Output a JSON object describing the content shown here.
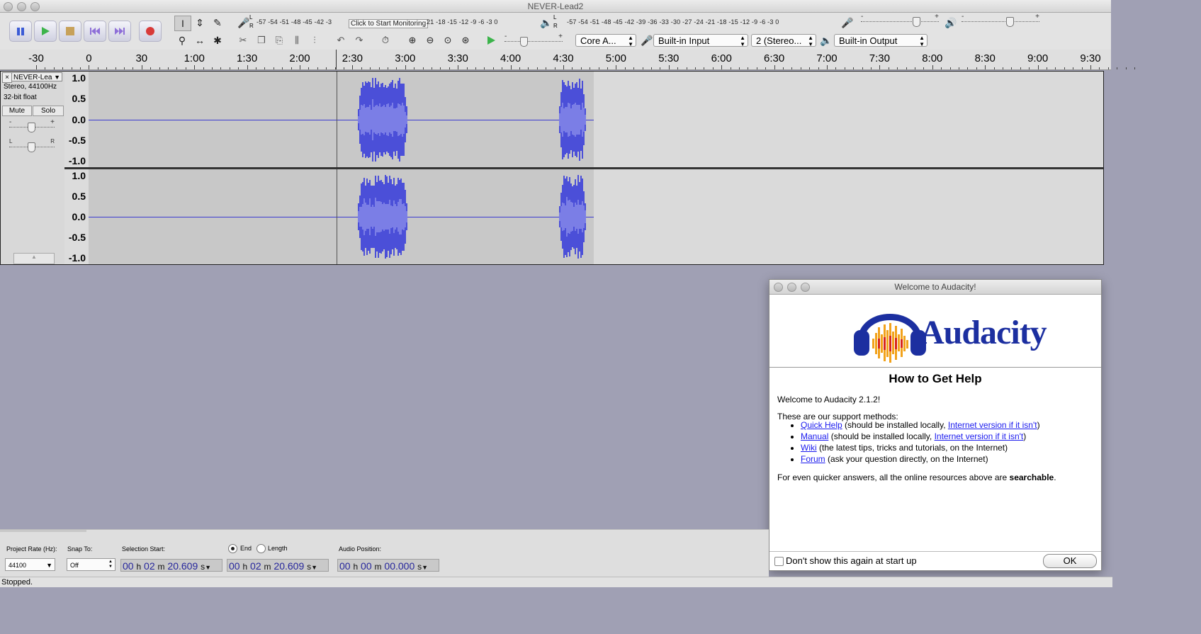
{
  "window": {
    "title": "NEVER-Lead2"
  },
  "meters": {
    "record_scale": "-57 -54 -51 -48 -45 -42 -3",
    "record_scale_right": "21 -18 -15 -12 -9 -6 -3 0",
    "record_tip": "Click to Start Monitoring",
    "play_scale": "-57 -54 -51 -48 -45 -42 -39 -36 -33 -30 -27 -24 -21 -18 -15 -12 -9 -6 -3 0",
    "lr_left": "L",
    "lr_right": "R"
  },
  "device": {
    "host": "Core A...",
    "input": "Built-in Input",
    "channels": "2 (Stereo...",
    "output": "Built-in Output"
  },
  "slider_marks": {
    "minus": "-",
    "plus": "+"
  },
  "ruler": [
    "-30",
    "0",
    "30",
    "1:00",
    "1:30",
    "2:00",
    "2:30",
    "3:00",
    "3:30",
    "4:00",
    "4:30",
    "5:00",
    "5:30",
    "6:00",
    "6:30",
    "7:00",
    "7:30",
    "8:00",
    "8:30",
    "9:00",
    "9:30"
  ],
  "track": {
    "close": "×",
    "name": "NEVER-Lea",
    "format": "Stereo, 44100Hz",
    "bits": "32-bit float",
    "mute": "Mute",
    "solo": "Solo",
    "pan_left": "L",
    "pan_right": "R",
    "gain_minus": "-",
    "gain_plus": "+"
  },
  "vaxis": [
    "1.0",
    "0.5",
    "0.0",
    "-0.5",
    "-1.0"
  ],
  "welcome": {
    "title": "Welcome to Audacity!",
    "logo_text": "Audacity",
    "heading": "How to Get Help",
    "intro": "Welcome to Audacity 2.1.2!",
    "methods_label": "These are our support methods:",
    "items": [
      {
        "link": "Quick Help",
        "text": " (should be installed locally, ",
        "link2": "Internet version if it isn't",
        "tail": ")"
      },
      {
        "link": "Manual",
        "text": " (should be installed locally, ",
        "link2": "Internet version if it isn't",
        "tail": ")"
      },
      {
        "link": "Wiki",
        "text": " (the latest tips, tricks and tutorials, on the Internet)",
        "link2": "",
        "tail": ""
      },
      {
        "link": "Forum",
        "text": " (ask your question directly, on the Internet)",
        "link2": "",
        "tail": ""
      }
    ],
    "quicker_prefix": "For even quicker answers, all the online resources above are ",
    "quicker_bold": "searchable",
    "quicker_suffix": ".",
    "dont_show": "Don't show this again at start up",
    "ok": "OK"
  },
  "selection_bar": {
    "rate_label": "Project Rate (Hz):",
    "rate": "44100",
    "snap_label": "Snap To:",
    "snap": "Off",
    "sel_start_label": "Selection Start:",
    "end_label": "End",
    "length_label": "Length",
    "audio_pos_label": "Audio Position:",
    "start": {
      "h": "00",
      "m": "02",
      "s": "20.609"
    },
    "end": {
      "h": "00",
      "m": "02",
      "s": "20.609"
    },
    "pos": {
      "h": "00",
      "m": "00",
      "s": "00.000"
    },
    "unit_h": "h",
    "unit_m": "m",
    "unit_s": "s"
  },
  "status": "Stopped."
}
